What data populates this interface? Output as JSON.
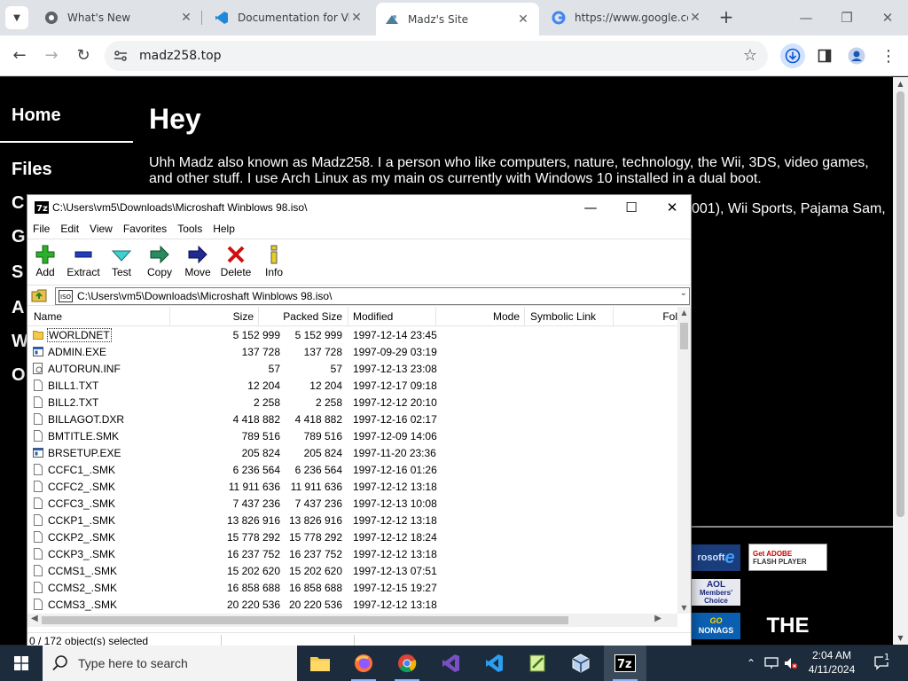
{
  "browser": {
    "tabs": [
      {
        "label": "What's New"
      },
      {
        "label": "Documentation for Visual Studio Code"
      },
      {
        "label": "Madz's Site"
      },
      {
        "label": "https://www.google.com"
      }
    ],
    "new_tab": "+",
    "url": "madz258.top"
  },
  "page": {
    "nav": [
      "Home",
      "Files",
      "C",
      "G",
      "S",
      "A",
      "W",
      "O"
    ],
    "heading": "Hey",
    "intro": "Uhh Madz also known as Madz258. I a person who like computers, nature, technology, the Wii, 3DS, video games, and other stuff. I use Arch Linux as my main os currently with Windows 10 installed in a dual boot.",
    "fragment": "001), Wii Sports, Pajama Sam,",
    "badges": {
      "ie": "rosoft",
      "flash_line1": "Get ADOBE",
      "flash_line2": "FLASH PLAYER",
      "aol_line1": "AOL",
      "aol_line2": "Members'",
      "aol_line3": "Choice",
      "go_line1": "GO",
      "go_line2": "NONAGS",
      "the": "THE"
    }
  },
  "zip": {
    "title": "C:\\Users\\vm5\\Downloads\\Microshaft Winblows 98.iso\\",
    "menu": [
      "File",
      "Edit",
      "View",
      "Favorites",
      "Tools",
      "Help"
    ],
    "tools": [
      "Add",
      "Extract",
      "Test",
      "Copy",
      "Move",
      "Delete",
      "Info"
    ],
    "address": "C:\\Users\\vm5\\Downloads\\Microshaft Winblows 98.iso\\",
    "columns": {
      "name": "Name",
      "size": "Size",
      "packed": "Packed Size",
      "modified": "Modified",
      "mode": "Mode",
      "symlink": "Symbolic Link",
      "folders": "Fol"
    },
    "rows": [
      {
        "name": "WORLDNET",
        "size": "5 152 999",
        "packed": "5 152 999",
        "modified": "1997-12-14 23:45",
        "kind": "folder"
      },
      {
        "name": "ADMIN.EXE",
        "size": "137 728",
        "packed": "137 728",
        "modified": "1997-09-29 03:19",
        "kind": "exe"
      },
      {
        "name": "AUTORUN.INF",
        "size": "57",
        "packed": "57",
        "modified": "1997-12-13 23:08",
        "kind": "inf"
      },
      {
        "name": "BILL1.TXT",
        "size": "12 204",
        "packed": "12 204",
        "modified": "1997-12-17 09:18",
        "kind": "file"
      },
      {
        "name": "BILL2.TXT",
        "size": "2 258",
        "packed": "2 258",
        "modified": "1997-12-12 20:10",
        "kind": "file"
      },
      {
        "name": "BILLAGOT.DXR",
        "size": "4 418 882",
        "packed": "4 418 882",
        "modified": "1997-12-16 02:17",
        "kind": "file"
      },
      {
        "name": "BMTITLE.SMK",
        "size": "789 516",
        "packed": "789 516",
        "modified": "1997-12-09 14:06",
        "kind": "file"
      },
      {
        "name": "BRSETUP.EXE",
        "size": "205 824",
        "packed": "205 824",
        "modified": "1997-11-20 23:36",
        "kind": "exe"
      },
      {
        "name": "CCFC1_.SMK",
        "size": "6 236 564",
        "packed": "6 236 564",
        "modified": "1997-12-16 01:26",
        "kind": "file"
      },
      {
        "name": "CCFC2_.SMK",
        "size": "11 911 636",
        "packed": "11 911 636",
        "modified": "1997-12-12 13:18",
        "kind": "file"
      },
      {
        "name": "CCFC3_.SMK",
        "size": "7 437 236",
        "packed": "7 437 236",
        "modified": "1997-12-13 10:08",
        "kind": "file"
      },
      {
        "name": "CCKP1_.SMK",
        "size": "13 826 916",
        "packed": "13 826 916",
        "modified": "1997-12-12 13:18",
        "kind": "file"
      },
      {
        "name": "CCKP2_.SMK",
        "size": "15 778 292",
        "packed": "15 778 292",
        "modified": "1997-12-12 18:24",
        "kind": "file"
      },
      {
        "name": "CCKP3_.SMK",
        "size": "16 237 752",
        "packed": "16 237 752",
        "modified": "1997-12-12 13:18",
        "kind": "file"
      },
      {
        "name": "CCMS1_.SMK",
        "size": "15 202 620",
        "packed": "15 202 620",
        "modified": "1997-12-13 07:51",
        "kind": "file"
      },
      {
        "name": "CCMS2_.SMK",
        "size": "16 858 688",
        "packed": "16 858 688",
        "modified": "1997-12-15 19:27",
        "kind": "file"
      },
      {
        "name": "CCMS3_.SMK",
        "size": "20 220 536",
        "packed": "20 220 536",
        "modified": "1997-12-12 13:18",
        "kind": "file"
      }
    ],
    "status": "0 / 172 object(s) selected"
  },
  "taskbar": {
    "search_placeholder": "Type here to search",
    "time": "2:04 AM",
    "date": "4/11/2024",
    "notifications": "1"
  },
  "colors": {
    "accent": "#1a73e8",
    "taskbar": "#1c2c3c",
    "page_bg": "#000000"
  }
}
